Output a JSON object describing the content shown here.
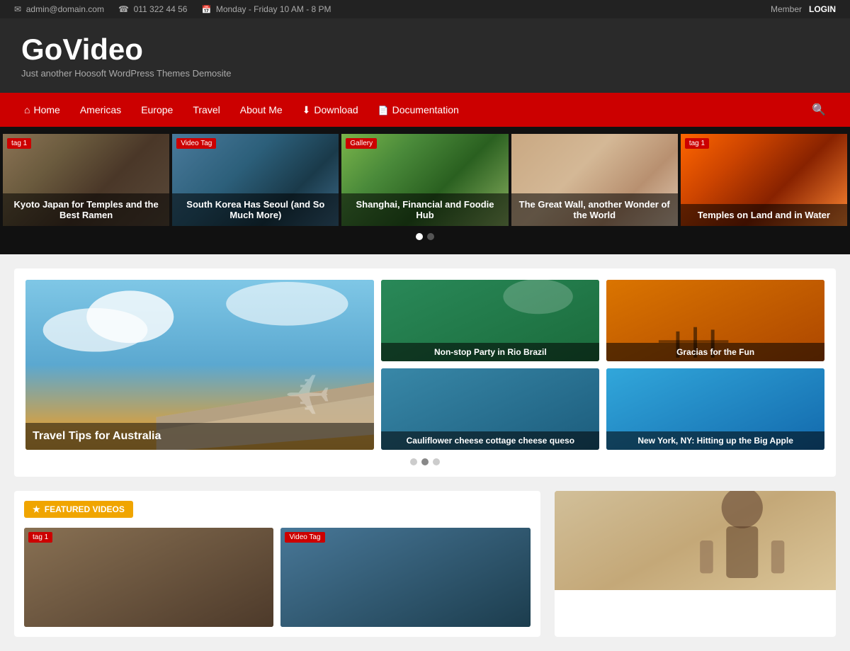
{
  "topbar": {
    "email": "admin@domain.com",
    "phone": "011 322 44 56",
    "hours": "Monday - Friday 10 AM - 8 PM",
    "member": "Member",
    "login": "LOGIN"
  },
  "header": {
    "title": "GoVideo",
    "subtitle": "Just another Hoosoft WordPress Themes Demosite"
  },
  "nav": {
    "items": [
      {
        "label": "Home",
        "icon": "home"
      },
      {
        "label": "Americas",
        "icon": ""
      },
      {
        "label": "Europe",
        "icon": ""
      },
      {
        "label": "Travel",
        "icon": ""
      },
      {
        "label": "About Me",
        "icon": ""
      },
      {
        "label": "Download",
        "icon": "download"
      },
      {
        "label": "Documentation",
        "icon": "doc"
      }
    ]
  },
  "slider": {
    "items": [
      {
        "tag": "tag 1",
        "title": "Kyoto Japan for Temples and the Best Ramen",
        "bg_class": "slide-1"
      },
      {
        "tag": "Video Tag",
        "title": "South Korea Has Seoul (and So Much More)",
        "bg_class": "slide-2"
      },
      {
        "tag": "Gallery",
        "title": "Shanghai, Financial and Foodie Hub",
        "bg_class": "slide-3"
      },
      {
        "tag": "",
        "title": "The Great Wall, another Wonder of the World",
        "bg_class": "slide-4"
      },
      {
        "tag": "tag 1",
        "title": "Temples on Land and in Water",
        "bg_class": "slide-5"
      }
    ],
    "dots": [
      {
        "active": true
      },
      {
        "active": false
      }
    ]
  },
  "featured": {
    "main": {
      "title": "Travel Tips for Australia"
    },
    "side_cards": [
      {
        "title": "Non-stop Party in Rio Brazil",
        "bg_class": "side-card-1"
      },
      {
        "title": "Cauliflower cheese cottage cheese queso",
        "bg_class": "side-card-2"
      },
      {
        "title": "Gracias for the Fun",
        "bg_class": "side-card-3"
      },
      {
        "title": "New York, NY: Hitting up the Big Apple",
        "bg_class": "side-card-4"
      }
    ],
    "dots": [
      {
        "active": false
      },
      {
        "active": true
      },
      {
        "active": false
      }
    ]
  },
  "featured_videos": {
    "label": "FEATURED VIDEOS",
    "label_icon": "★",
    "cards": [
      {
        "tag": "tag 1",
        "bg_class": "video-card-1"
      },
      {
        "tag": "Video Tag",
        "bg_class": "video-card-2"
      }
    ]
  }
}
